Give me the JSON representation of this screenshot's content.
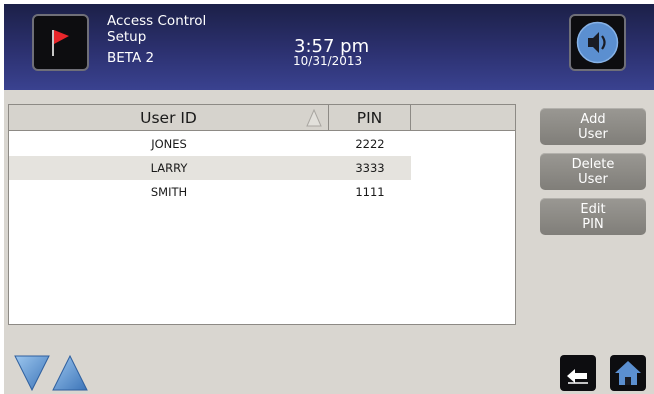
{
  "header": {
    "title_line1": "Access Control",
    "title_line2": "Setup",
    "title_line3": "BETA 2",
    "time": "3:57 pm",
    "date": "10/31/2013",
    "left_icon": "red-flag-icon",
    "right_icon": "speaker-icon"
  },
  "table": {
    "columns": [
      "User ID",
      "PIN"
    ],
    "sort_column": "User ID",
    "sort_direction": "ascending",
    "rows": [
      {
        "user_id": "JONES",
        "pin": "2222"
      },
      {
        "user_id": "LARRY",
        "pin": "3333"
      },
      {
        "user_id": "SMITH",
        "pin": "1111"
      }
    ],
    "selected_row": 1
  },
  "buttons": {
    "add": {
      "line1": "Add",
      "line2": "User"
    },
    "delete": {
      "line1": "Delete",
      "line2": "User"
    },
    "edit": {
      "line1": "Edit",
      "line2": "PIN"
    }
  },
  "footer": {
    "scroll_down_icon": "scroll-down-icon",
    "scroll_up_icon": "scroll-up-icon",
    "back_icon": "back-arrow-icon",
    "home_icon": "home-icon"
  },
  "colors": {
    "header_top": "#1c2048",
    "header_bottom": "#3a4290",
    "flag": "#e8262b",
    "speaker_blue": "#5b8fd0",
    "button_gray": "#8c8a85",
    "panel_bg": "#d9d6d0",
    "nav_blue": "#6aa1dc"
  }
}
